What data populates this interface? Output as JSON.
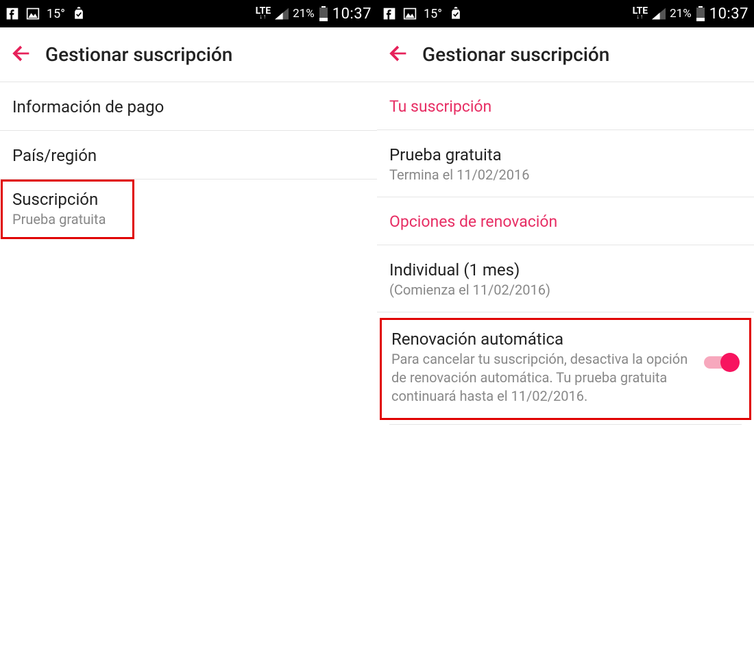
{
  "status": {
    "temp": "15°",
    "network_label": "LTE",
    "battery_pct": "21%",
    "time": "10:37"
  },
  "accent_color": "#e6215a",
  "left": {
    "header_title": "Gestionar suscripción",
    "items": [
      {
        "title": "Información de pago"
      },
      {
        "title": "País/región"
      },
      {
        "title": "Suscripción",
        "sub": "Prueba gratuita",
        "highlighted": true
      }
    ]
  },
  "right": {
    "header_title": "Gestionar suscripción",
    "section1_header": "Tu suscripción",
    "trial": {
      "title": "Prueba gratuita",
      "sub": "Termina el 11/02/2016"
    },
    "section2_header": "Opciones de renovación",
    "plan": {
      "title": "Individual (1 mes)",
      "sub": "(Comienza el 11/02/2016)"
    },
    "auto_renew": {
      "title": "Renovación automática",
      "desc": "Para cancelar tu suscripción, desactiva la opción de renovación automática. Tu prueba gratuita continuará hasta el 11/02/2016.",
      "enabled": true
    }
  }
}
